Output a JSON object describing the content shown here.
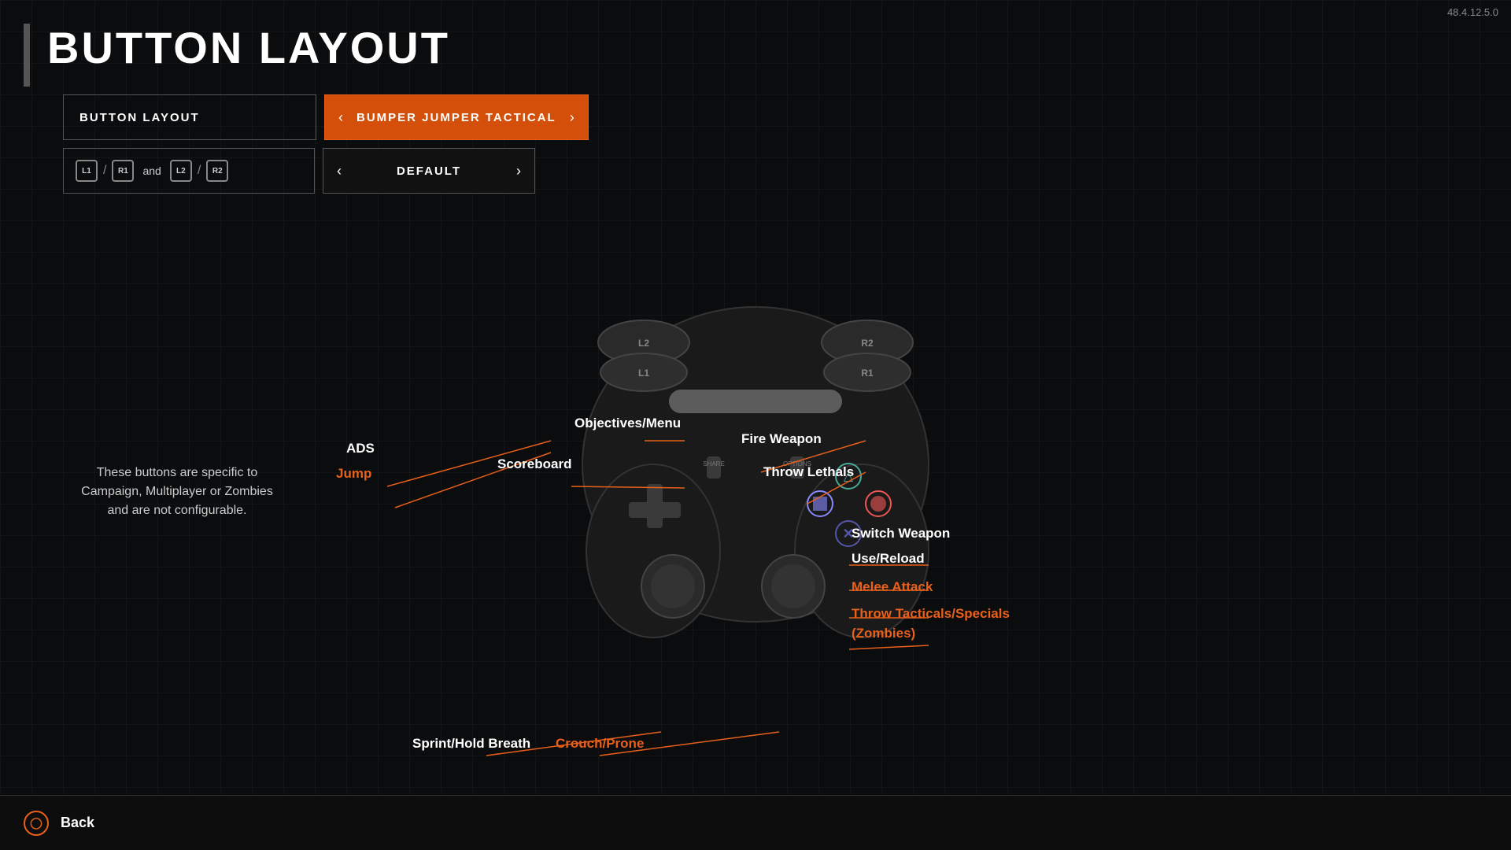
{
  "version": "48.4.12.5.0",
  "pageTitle": "BUTTON LAYOUT",
  "controls": {
    "layout_label": "BUTTON LAYOUT",
    "layout_value": "BUMPER JUMPER TACTICAL",
    "secondary_value": "DEFAULT"
  },
  "buttonIcons": {
    "left1": "L1",
    "right1": "R1",
    "and": "and",
    "left2": "L2",
    "right2": "R2"
  },
  "labels": {
    "ads": "ADS",
    "jump": "Jump",
    "scoreboard": "Scoreboard",
    "objectives_menu": "Objectives/Menu",
    "fire_weapon": "Fire Weapon",
    "throw_lethals": "Throw Lethals",
    "switch_weapon": "Switch Weapon",
    "use_reload": "Use/Reload",
    "melee_attack": "Melee Attack",
    "throw_tacticals": "Throw Tacticals/Specials",
    "throw_tacticals2": "(Zombies)",
    "sprint_hold_breath": "Sprint/Hold Breath",
    "crouch_prone": "Crouch/Prone",
    "info": "These buttons are specific to\nCampaign, Multiplayer or Zombies\nand are not configurable."
  },
  "back": "Back"
}
